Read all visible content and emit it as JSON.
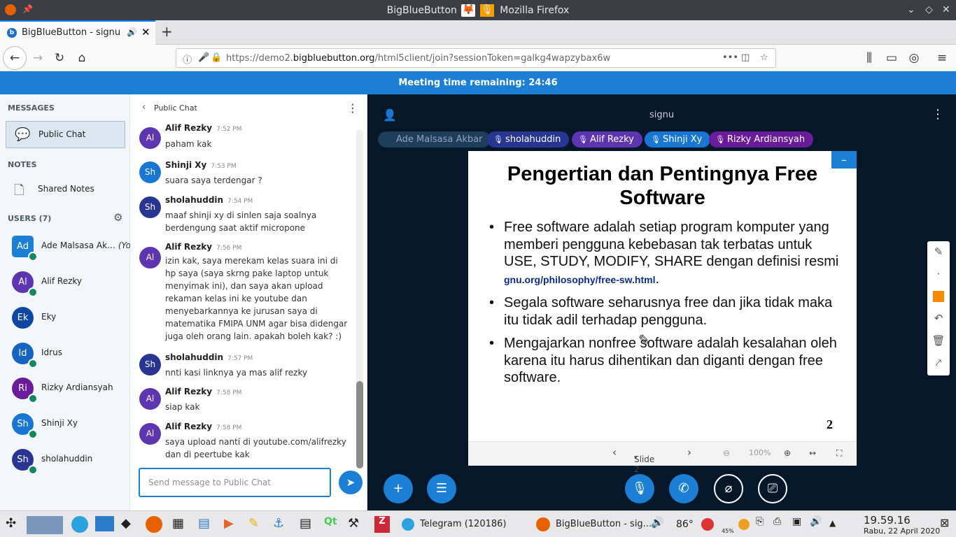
{
  "os_titlebar": {
    "title_left": "BigBlueButton",
    "title_right": "Mozilla Firefox"
  },
  "browser": {
    "tab_title": "BigBlueButton - signu",
    "url_prefix": "https://demo2.",
    "url_domain": "bigbluebutton.org",
    "url_path": "/html5client/join?sessionToken=galkg4wapzybax6w"
  },
  "banner": {
    "text": "Meeting time remaining: 24:46"
  },
  "sidebar": {
    "messages_heading": "MESSAGES",
    "public_chat": "Public Chat",
    "notes_heading": "NOTES",
    "shared_notes": "Shared Notes",
    "users_heading": "USERS (7)",
    "users": [
      {
        "initials": "Ad",
        "name": "Ade Malsasa Ak…",
        "you": "(You)",
        "color": "#1b7fd5"
      },
      {
        "initials": "Al",
        "name": "Alif Rezky",
        "you": "",
        "color": "#5e35b1"
      },
      {
        "initials": "Ek",
        "name": "Eky",
        "you": "",
        "color": "#0d47a1"
      },
      {
        "initials": "Id",
        "name": "Idrus",
        "you": "",
        "color": "#1565c0"
      },
      {
        "initials": "Ri",
        "name": "Rizky Ardiansyah",
        "you": "",
        "color": "#6a1b9a"
      },
      {
        "initials": "Sh",
        "name": "Shinji Xy",
        "you": "",
        "color": "#1976d2"
      },
      {
        "initials": "Sh",
        "name": "sholahuddin",
        "you": "",
        "color": "#283593"
      }
    ]
  },
  "chat": {
    "header": "Public Chat",
    "input_placeholder": "Send message to Public Chat",
    "messages": [
      {
        "initials": "Al",
        "name": "Alif Rezky",
        "time": "7:52 PM",
        "text": "paham kak"
      },
      {
        "initials": "Sh",
        "name": "Shinji Xy",
        "time": "7:53 PM",
        "text": "suara saya terdengar ?"
      },
      {
        "initials": "Sh",
        "name": "sholahuddin",
        "time": "7:54 PM",
        "text": "maaf shinji xy di sinlen saja soalnya berdengung saat aktif micropone"
      },
      {
        "initials": "Al",
        "name": "Alif Rezky",
        "time": "7:56 PM",
        "text": "izin kak, saya merekam kelas suara ini di hp saya (saya skrng pake laptop untuk menyimak ini), dan saya akan upload rekaman kelas ini ke youtube dan menyebarkannya ke jurusan saya di matematika FMIPA UNM agar bisa didengar juga oleh orang lain. apakah boleh kak? :)"
      },
      {
        "initials": "Sh",
        "name": "sholahuddin",
        "time": "7:57 PM",
        "text": "nnti kasi linknya ya mas alif rezky"
      },
      {
        "initials": "Al",
        "name": "Alif Rezky",
        "time": "7:58 PM",
        "text": "siap kak"
      },
      {
        "initials": "Al",
        "name": "Alif Rezky",
        "time": "7:58 PM",
        "text": "saya upload nanti di youtube.com/alifrezky dan di peertube kak"
      }
    ]
  },
  "presentation": {
    "meeting_name": "signu",
    "talkers": [
      {
        "name": "Ade Malsasa Akbar",
        "color": "#1e3d59"
      },
      {
        "name": "sholahuddin",
        "color": "#283593"
      },
      {
        "name": "Alif Rezky",
        "color": "#5e35b1"
      },
      {
        "name": "Shinji Xy",
        "color": "#1976d2"
      },
      {
        "name": "Rizky Ardiansyah",
        "color": "#6a1b9a"
      }
    ],
    "slide_title": "Pengertian dan Pentingnya Free Software",
    "bullets": [
      "Free software adalah setiap program komputer yang memberi pengguna kebebasan tak terbatas untuk USE, STUDY, MODIFY, SHARE dengan definisi resmi ",
      "Segala software seharusnya free dan jika tidak maka itu tidak adil terhadap pengguna.",
      "Mengajarkan nonfree software adalah kesalahan oleh karena itu harus dihentikan dan diganti dengan free software."
    ],
    "bullet_link": "gnu.org/philosophy/free-sw.html",
    "page_number": "2",
    "slide_selector": "Slide 2",
    "zoom": "100%"
  },
  "taskbar": {
    "telegram": "Telegram (120186)",
    "firefox_task": "BigBlueButton - sig...",
    "temperature": "86°",
    "battery": "45%",
    "time": "19.59.16",
    "date": "Rabu, 22 April 2020"
  }
}
